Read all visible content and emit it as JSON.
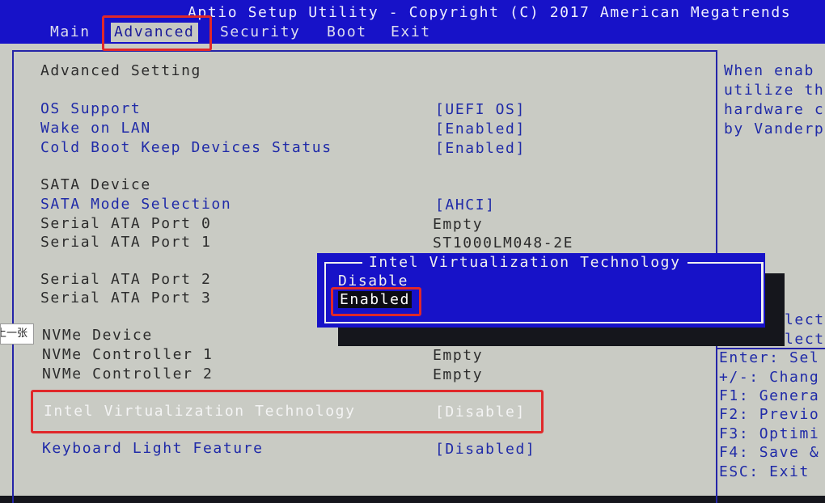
{
  "header": {
    "title": "Aptio Setup Utility - Copyright (C) 2017 American Megatrends",
    "tabs": [
      "Main",
      "Advanced",
      "Security",
      "Boot",
      "Exit"
    ],
    "active_tab": "Advanced"
  },
  "main": {
    "section_title": "Advanced Setting",
    "rows": [
      {
        "label": "OS Support",
        "value": "[UEFI OS]"
      },
      {
        "label": "Wake on LAN",
        "value": "[Enabled]"
      },
      {
        "label": "Cold Boot Keep Devices Status",
        "value": "[Enabled]"
      },
      {
        "label": "SATA Device"
      },
      {
        "label": "SATA Mode Selection",
        "value": "[AHCI]"
      },
      {
        "label": "Serial ATA Port 0",
        "value": "Empty"
      },
      {
        "label": "Serial ATA Port 1",
        "value": "ST1000LM048-2E"
      },
      {
        "label": "Serial ATA Port 2"
      },
      {
        "label": "Serial ATA Port 3"
      },
      {
        "label": "NVMe Device"
      },
      {
        "label": "NVMe Controller 1",
        "value": "Empty"
      },
      {
        "label": "NVMe Controller 2",
        "value": "Empty"
      },
      {
        "label": "Intel Virtualization Technology",
        "value": "[Disable]"
      },
      {
        "label": "Keyboard Light Feature",
        "value": "[Disabled]"
      }
    ]
  },
  "help": {
    "lines": [
      "When enab",
      "utilize th",
      "hardware c",
      "by Vanderp"
    ],
    "keys": [
      "lect",
      "lect",
      "Enter: Sel",
      "+/-: Chang",
      "F1: Genera",
      "F2: Previo",
      "F3: Optimi",
      "F4: Save &",
      "ESC: Exit"
    ]
  },
  "popup": {
    "title": "Intel Virtualization Technology",
    "options": [
      "Disable",
      "Enabled"
    ],
    "selected": "Enabled"
  },
  "overlay": {
    "tooltip": "上一张"
  },
  "colors": {
    "header_blue": "#1712c8",
    "background": "#c9cbc4",
    "setting_blue": "#1f2aa8",
    "annotation_red": "#e0282a"
  }
}
